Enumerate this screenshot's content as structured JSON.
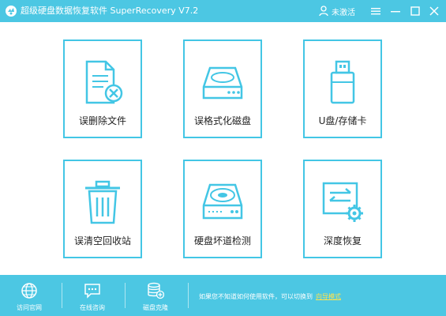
{
  "window": {
    "title": "超级硬盘数据恢复软件 SuperRecovery V7.2",
    "account_label": "未激活",
    "colors": {
      "accent": "#4cc7e3",
      "card_border": "#43c6e5",
      "link": "#ffe34d"
    }
  },
  "cards": [
    {
      "label": "误删除文件",
      "icon": "deleted-file-icon"
    },
    {
      "label": "误格式化磁盘",
      "icon": "hard-disk-icon"
    },
    {
      "label": "U盘/存储卡",
      "icon": "usb-drive-icon"
    },
    {
      "label": "误清空回收站",
      "icon": "recycle-bin-icon"
    },
    {
      "label": "硬盘坏道检测",
      "icon": "disk-scan-icon"
    },
    {
      "label": "深度恢复",
      "icon": "deep-recovery-icon"
    }
  ],
  "bottom": {
    "items": [
      {
        "label": "访问官网",
        "icon": "globe-icon"
      },
      {
        "label": "在线咨询",
        "icon": "chat-icon"
      },
      {
        "label": "磁盘克隆",
        "icon": "disk-clone-icon"
      }
    ],
    "help_text": "如果您不知道如何使用软件，可以切换到",
    "help_link": "向导模式"
  }
}
